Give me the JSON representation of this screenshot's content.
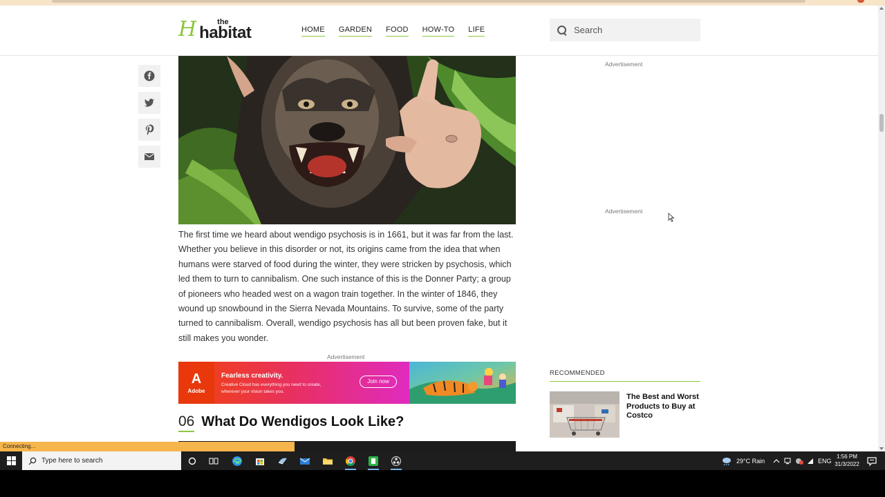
{
  "header": {
    "logo_the": "the",
    "logo_main": "habitat",
    "nav": [
      "HOME",
      "GARDEN",
      "FOOD",
      "HOW-TO",
      "LIFE"
    ],
    "search_placeholder": "Search"
  },
  "article": {
    "paragraph": "The first time we heard about wendigo psychosis is in 1661, but it was far from the last. Whether you believe in this disorder or not, its origins came from the idea that when humans were starved of food during the winter, they were stricken by psychosis, which led them to turn to cannibalism. One such instance of this is the Donner Party; a group of pioneers who headed west on a wagon train together. In the winter of 1846, they wound up snowbound in the Sierra Nevada Mountains. To survive, some of the party turned to cannibalism. Overall, wendigo psychosis has all but been proven fake, but it still makes you wonder.",
    "section_number": "06",
    "section_title": "What Do Wendigos Look Like?"
  },
  "ads": {
    "label": "Advertisement",
    "adobe": {
      "brand": "Adobe",
      "headline": "Fearless creativity.",
      "body": "Creative Cloud has everything you need to create, wherever your vision takes you.",
      "cta": "Join now"
    }
  },
  "sidebar": {
    "recommended_label": "RECOMMENDED",
    "recommended_title": "The Best and Worst Products to Buy at Costco"
  },
  "status": "Connecting...",
  "taskbar": {
    "search_placeholder": "Type here to search",
    "weather": "29°C  Rain",
    "language": "ENG",
    "time": "1:56 PM",
    "date": "31/3/2022"
  },
  "colors": {
    "brand_green": "#8cc63f",
    "adobe_red": "#e8380c",
    "status_orange": "#f7b54d"
  }
}
